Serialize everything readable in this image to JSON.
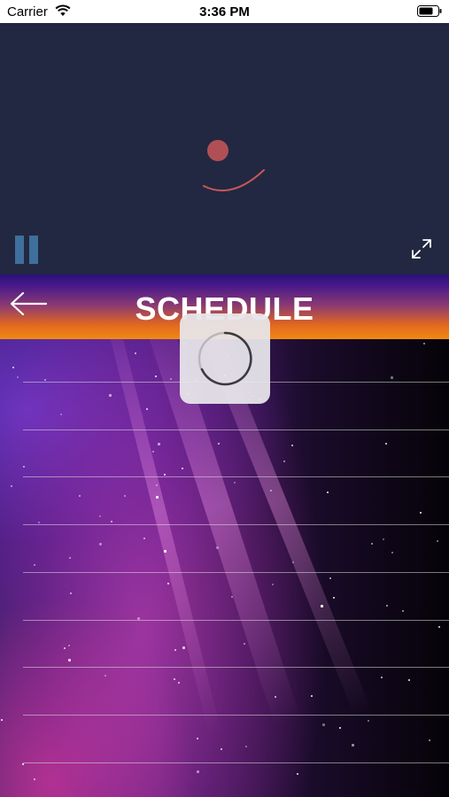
{
  "status_bar": {
    "carrier": "Carrier",
    "time": "3:36 PM",
    "icons": [
      "wifi-icon",
      "battery-icon"
    ]
  },
  "player": {
    "state": "loading",
    "icons": [
      "pause-icon",
      "fullscreen-icon",
      "spinner-icon"
    ],
    "accent_color": "#c8575a"
  },
  "header": {
    "title": "SCHEDULE",
    "back_icon": "arrow-left-icon"
  },
  "schedule": {
    "rows": [
      "",
      "",
      "",
      "",
      "",
      "",
      "",
      "",
      ""
    ]
  },
  "loading_overlay": {
    "icon": "activity-spinner-icon"
  }
}
